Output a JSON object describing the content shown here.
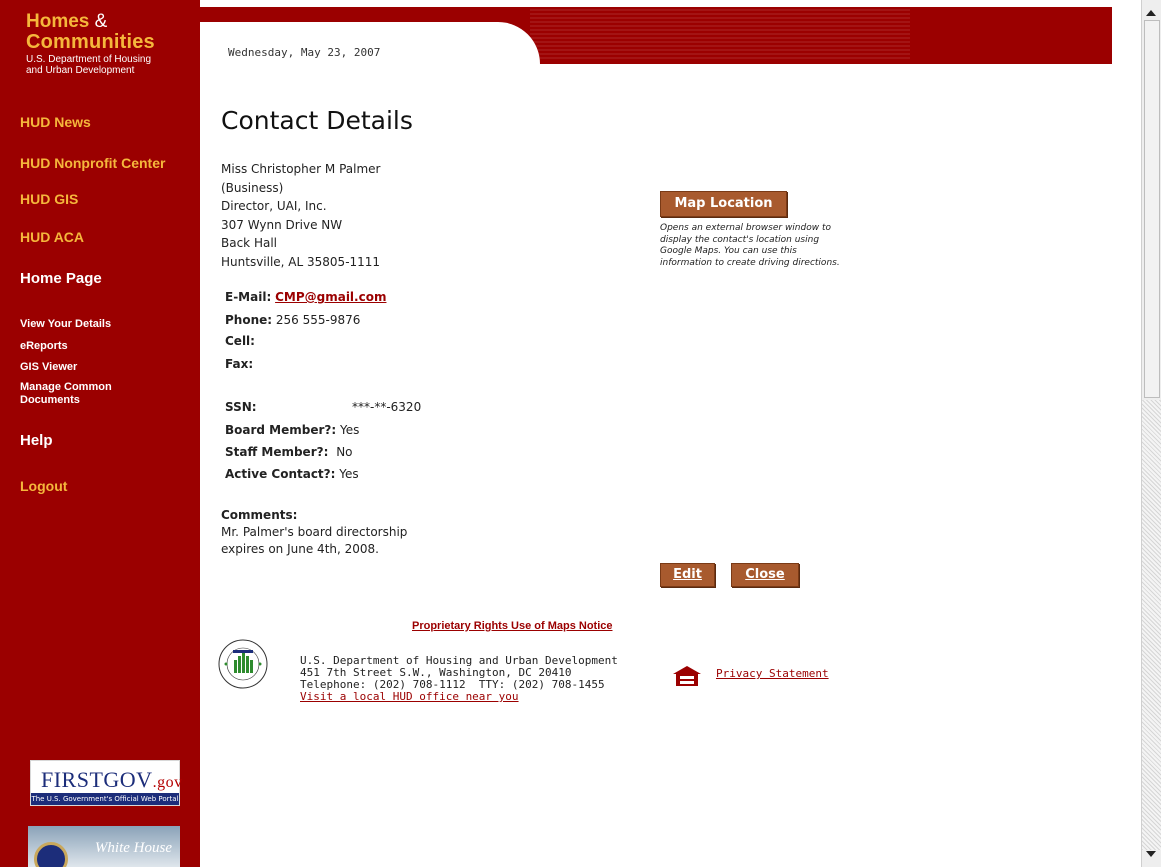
{
  "brand": {
    "title_line1": "Homes",
    "amp": "&",
    "title_line2": "Communities",
    "subtitle_line1": "U.S. Department of Housing",
    "subtitle_line2": "and Urban Development"
  },
  "sidebar": {
    "links": [
      {
        "label": "HUD News"
      },
      {
        "label": "HUD Nonprofit Center"
      },
      {
        "label": "HUD GIS"
      },
      {
        "label": "HUD ACA"
      },
      {
        "label": "Home Page"
      },
      {
        "label": "View Your Details"
      },
      {
        "label": "eReports"
      },
      {
        "label": "GIS Viewer"
      },
      {
        "label": "Manage Common"
      },
      {
        "label": "Documents"
      },
      {
        "label": "Help"
      },
      {
        "label": "Logout"
      }
    ],
    "firstgov": {
      "logo_text": "FIRSTGOV",
      "logo_suffix": ".gov",
      "tagline": "The U.S. Government's Official Web Portal"
    },
    "whitehouse": {
      "logo_text": "White House"
    }
  },
  "header": {
    "date": "Wednesday, May 23, 2007"
  },
  "main": {
    "title": "Contact Details",
    "address_lines": [
      "Miss Christopher M Palmer",
      "(Business)",
      "Director, UAI, Inc.",
      "307 Wynn Drive NW",
      "Back Hall",
      "Huntsville, AL 35805-1111"
    ],
    "email_label": "E-Mail:",
    "email_value": "CMP@gmail.com",
    "phone_label": "Phone:",
    "phone_value": "256 555-9876",
    "cell_label": "Cell:",
    "fax_label": "Fax:",
    "ssn_label": "SSN:",
    "ssn_value": "***-**-6320",
    "board_label": "Board Member?:",
    "board_value": "Yes",
    "staff_label": "Staff Member?:",
    "staff_value": "No",
    "active_label": "Active Contact?:",
    "active_value": "Yes",
    "comments_label": "Comments:",
    "comments_lines": [
      "Mr. Palmer's board directorship",
      "expires on June 4th, 2008."
    ],
    "map_button": "Map Location",
    "map_note_lines": [
      "Opens an external browser window to",
      "display the contact's location using",
      "Google Maps. You can use this",
      "information to create driving directions."
    ],
    "edit_button": "Edit",
    "close_button": "Close"
  },
  "footer": {
    "notice": "Proprietary Rights Use of Maps Notice",
    "hud_lines": [
      "U.S. Department of Housing and Urban Development",
      "451 7th Street S.W., Washington, DC 20410",
      "Telephone: (202) 708-1112  TTY: (202) 708-1455"
    ],
    "hud_link": "Visit a local HUD office near you",
    "privacy": "Privacy Statement"
  },
  "colors": {
    "brand_red": "#9b0000",
    "gold": "#f5b73c",
    "button_brown": "#a85a2e"
  }
}
